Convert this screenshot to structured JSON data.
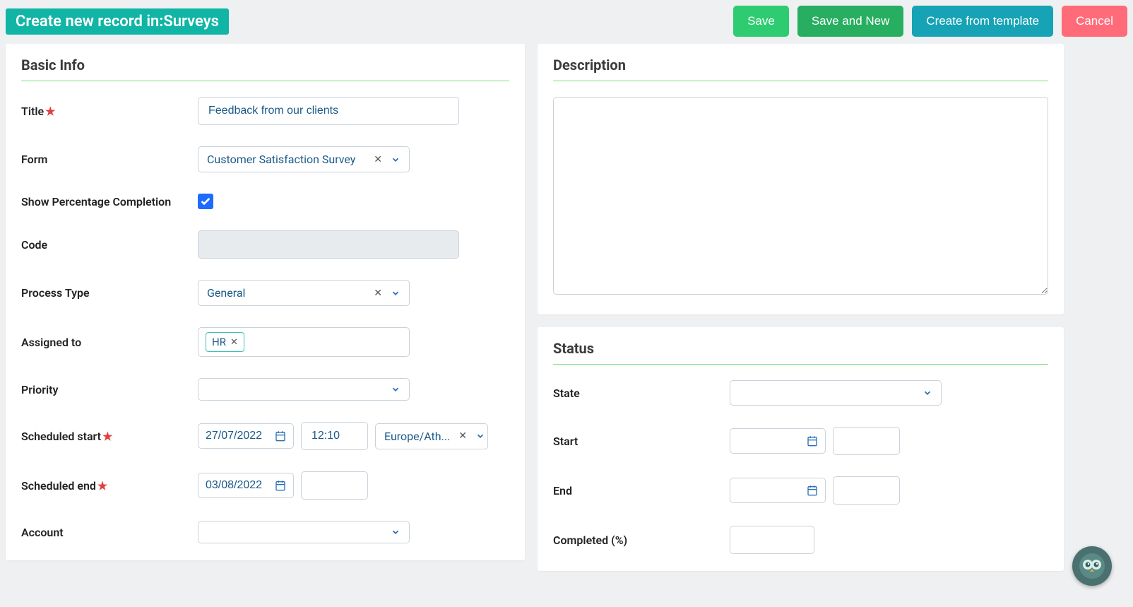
{
  "header": {
    "title": "Create new record in:Surveys",
    "buttons": {
      "save": "Save",
      "saveNew": "Save and New",
      "template": "Create from template",
      "cancel": "Cancel"
    }
  },
  "basicInfo": {
    "sectionTitle": "Basic Info",
    "labels": {
      "title": "Title",
      "form": "Form",
      "showPercentage": "Show Percentage Completion",
      "code": "Code",
      "processType": "Process Type",
      "assignedTo": "Assigned to",
      "priority": "Priority",
      "scheduledStart": "Scheduled start",
      "scheduledEnd": "Scheduled end",
      "account": "Account"
    },
    "values": {
      "title": "Feedback from our clients",
      "form": "Customer Satisfaction Survey",
      "showPercentage": true,
      "code": "",
      "processType": "General",
      "assignedTag": "HR",
      "priority": "",
      "scheduledStartDate": "27/07/2022",
      "scheduledStartTime": "12:10",
      "timezone": "Europe/Ath...",
      "scheduledEndDate": "03/08/2022",
      "scheduledEndTime": "",
      "account": ""
    }
  },
  "description": {
    "sectionTitle": "Description",
    "value": ""
  },
  "status": {
    "sectionTitle": "Status",
    "labels": {
      "state": "State",
      "start": "Start",
      "end": "End",
      "completed": "Completed (%)"
    },
    "values": {
      "state": "",
      "startDate": "",
      "startTime": "",
      "endDate": "",
      "endTime": "",
      "completed": ""
    }
  },
  "colors": {
    "teal": "#11b5a5",
    "green": "#2ecc71",
    "greenDark": "#27ae60",
    "tealBtn": "#16a3b5",
    "pink": "#ff6b79",
    "blue": "#1e6bff"
  }
}
